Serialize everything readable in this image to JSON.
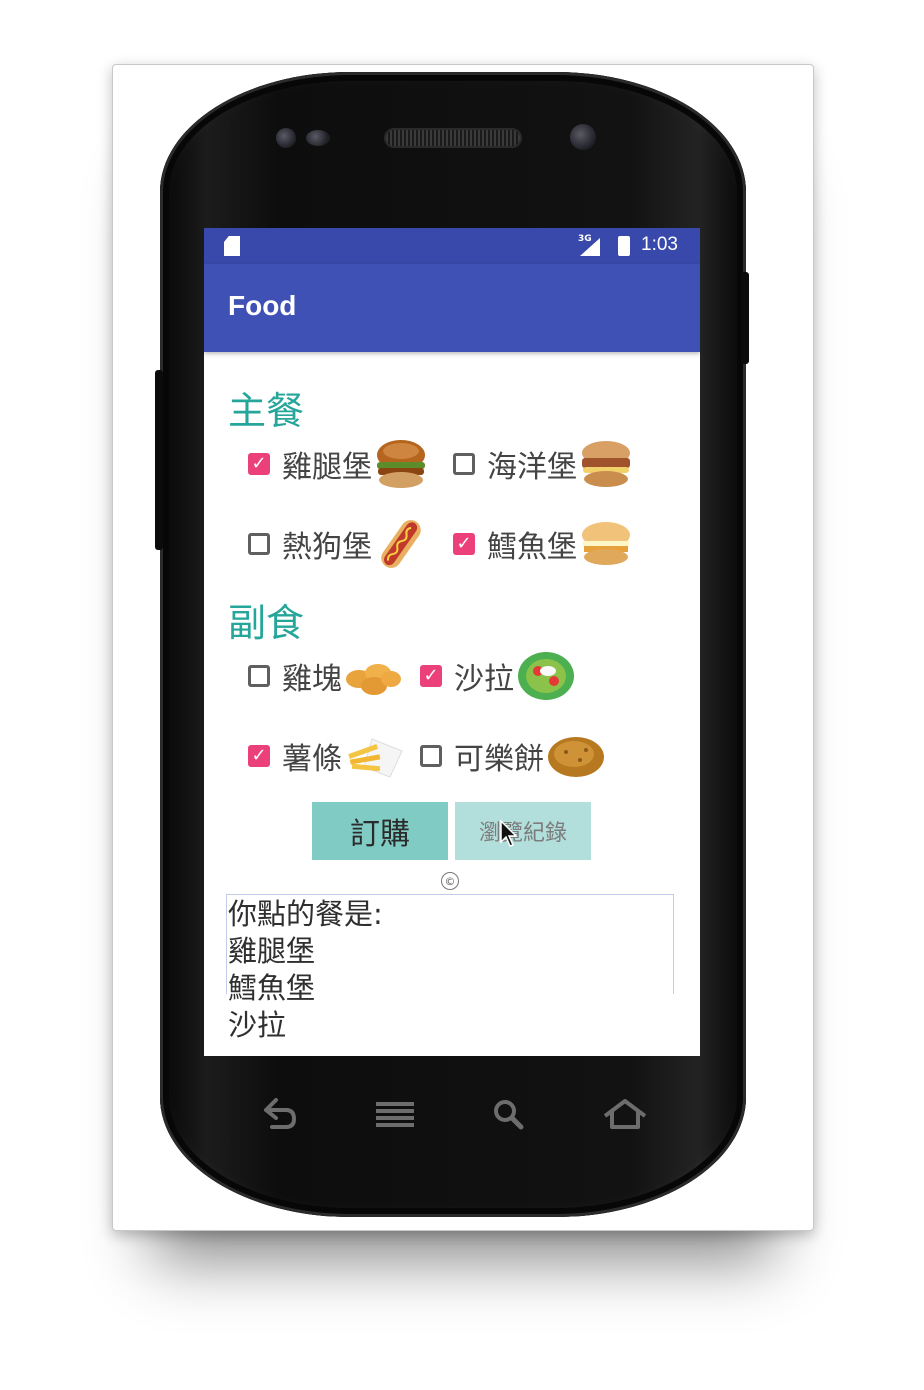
{
  "status_bar": {
    "network_type": "3G",
    "time": "1:03"
  },
  "app_bar": {
    "title": "Food"
  },
  "main_section": {
    "title": "主餐",
    "items": [
      {
        "label": "雞腿堡",
        "checked": true,
        "icon": "chicken-burger-image"
      },
      {
        "label": "海洋堡",
        "checked": false,
        "icon": "ocean-burger-image"
      },
      {
        "label": "熱狗堡",
        "checked": false,
        "icon": "hotdog-image"
      },
      {
        "label": "鱈魚堡",
        "checked": true,
        "icon": "fish-burger-image"
      }
    ]
  },
  "side_section": {
    "title": "副食",
    "items": [
      {
        "label": "雞塊",
        "checked": false,
        "icon": "nuggets-image"
      },
      {
        "label": "沙拉",
        "checked": true,
        "icon": "salad-image"
      },
      {
        "label": "薯條",
        "checked": true,
        "icon": "fries-image"
      },
      {
        "label": "可樂餅",
        "checked": false,
        "icon": "croquette-image"
      }
    ]
  },
  "buttons": {
    "order": "訂購",
    "history": "瀏覽紀錄"
  },
  "copyright_symbol": "©",
  "result": {
    "heading": "你點的餐是:",
    "lines": [
      "雞腿堡",
      "鱈魚堡",
      "沙拉"
    ]
  },
  "nav_keys": [
    "back-icon",
    "menu-icon",
    "search-icon",
    "home-icon"
  ],
  "colors": {
    "status_bar": "#3949ab",
    "app_bar": "#3f51b5",
    "section_title": "#26a69a",
    "checkbox_checked": "#ec407a",
    "button_order": "#80cbc4",
    "button_history": "#b2dfdb"
  }
}
